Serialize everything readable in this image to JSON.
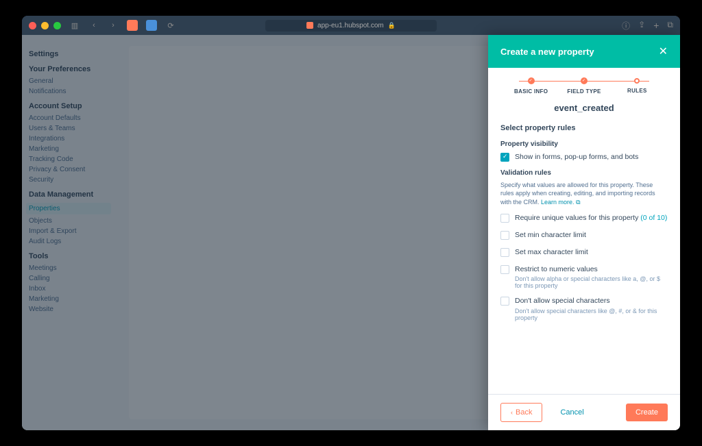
{
  "browser": {
    "url": "app-eu1.hubspot.com"
  },
  "sidebar": {
    "heading1": "Your Preferences",
    "items1": [
      "General",
      "Notifications"
    ],
    "heading2": "Account Setup",
    "items2": [
      "Account Defaults",
      "Users & Teams",
      "Integrations",
      "Marketing",
      "Tracking Code",
      "Privacy & Consent",
      "Security"
    ],
    "heading3": "Data Management",
    "items3": [
      "Properties",
      "Objects",
      "Import & Export",
      "Audit Logs"
    ],
    "heading4": "Tools",
    "items4": [
      "Meetings",
      "Calling",
      "Inbox",
      "Marketing",
      "Website"
    ]
  },
  "panel": {
    "title": "Create a new property",
    "steps": {
      "s1": "BASIC INFO",
      "s2": "FIELD TYPE",
      "s3": "RULES"
    },
    "property_name": "event_created",
    "section_title": "Select property rules",
    "visibility": {
      "label": "Property visibility",
      "opt1": "Show in forms, pop-up forms, and bots"
    },
    "validation": {
      "label": "Validation rules",
      "helper": "Specify what values are allowed for this property. These rules apply when creating, editing, and importing records with the CRM.",
      "learn_more": "Learn more.",
      "rules": {
        "unique": "Require unique values for this property",
        "unique_count": "(0 of 10)",
        "min": "Set min character limit",
        "max": "Set max character limit",
        "numeric": "Restrict to numeric values",
        "numeric_sub": "Don't allow alpha or special characters like a, @, or $ for this property",
        "nospecial": "Don't allow special characters",
        "nospecial_sub": "Don't allow special characters like @, #, or & for this property"
      }
    },
    "footer": {
      "back": "Back",
      "cancel": "Cancel",
      "create": "Create"
    }
  }
}
